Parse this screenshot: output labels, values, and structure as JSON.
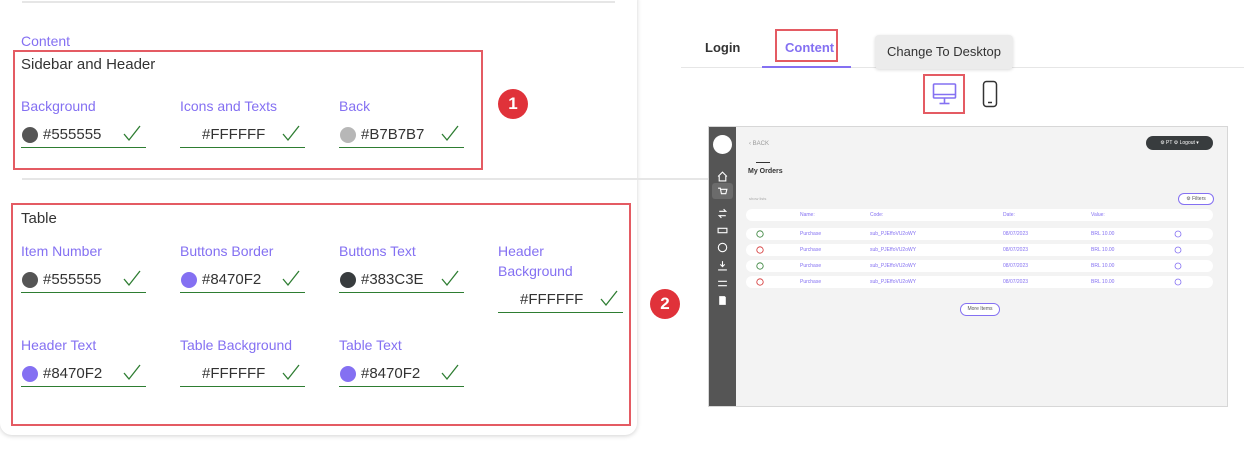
{
  "settings": {
    "section_label": "Content",
    "sidebar_header": {
      "title": "Sidebar and Header",
      "badge": "1",
      "fields": [
        {
          "label": "Background",
          "value": "#555555",
          "swatch": "#555555"
        },
        {
          "label": "Icons and Texts",
          "value": "#FFFFFF",
          "swatch": ""
        },
        {
          "label": "Back",
          "value": "#B7B7B7",
          "swatch": "#B7B7B7"
        }
      ]
    },
    "table": {
      "title": "Table",
      "badge": "2",
      "fields": [
        {
          "label": "Item Number",
          "value": "#555555",
          "swatch": "#555555"
        },
        {
          "label": "Buttons Border",
          "value": "#8470F2",
          "swatch": "#8470F2"
        },
        {
          "label": "Buttons Text",
          "value": "#383C3E",
          "swatch": "#383C3E"
        },
        {
          "label": "Header Background",
          "value": "#FFFFFF",
          "swatch": ""
        },
        {
          "label": "Header Text",
          "value": "#8470F2",
          "swatch": "#8470F2"
        },
        {
          "label": "Table Background",
          "value": "#FFFFFF",
          "swatch": ""
        },
        {
          "label": "Table Text",
          "value": "#8470F2",
          "swatch": "#8470F2"
        }
      ]
    }
  },
  "preview_panel": {
    "tabs": [
      {
        "label": "Login",
        "active": false
      },
      {
        "label": "Content",
        "active": true
      }
    ],
    "tooltip": "Change To Desktop",
    "devices": [
      "desktop-icon",
      "mobile-icon"
    ]
  },
  "mock": {
    "back": "‹  BACK",
    "topbar": "⚙ PT ⚙  Logout ▾",
    "title": "My Orders",
    "small": "show lists",
    "filter": "⚙ Filters",
    "columns": [
      "Name:",
      "Code:",
      "Date:",
      "Value:"
    ],
    "rows": [
      {
        "name": "Purchase",
        "code": "sub_PJEffoVU2oWY",
        "date": "08/07/2023",
        "value": "BRL 10.00"
      },
      {
        "name": "Purchase",
        "code": "sub_PJEffoVU2oWY",
        "date": "08/07/2023",
        "value": "BRL 10.00"
      },
      {
        "name": "Purchase",
        "code": "sub_PJEffoVU2oWY",
        "date": "08/07/2023",
        "value": "BRL 10.00"
      },
      {
        "name": "Purchase",
        "code": "sub_PJEffoVU2oWY",
        "date": "08/07/2023",
        "value": "BRL 10.00"
      }
    ],
    "more": "More Items"
  },
  "colors": {
    "accent": "#8470F2",
    "highlight": "#E45B63",
    "check": "#2E7D32",
    "sidebar": "#555555"
  }
}
